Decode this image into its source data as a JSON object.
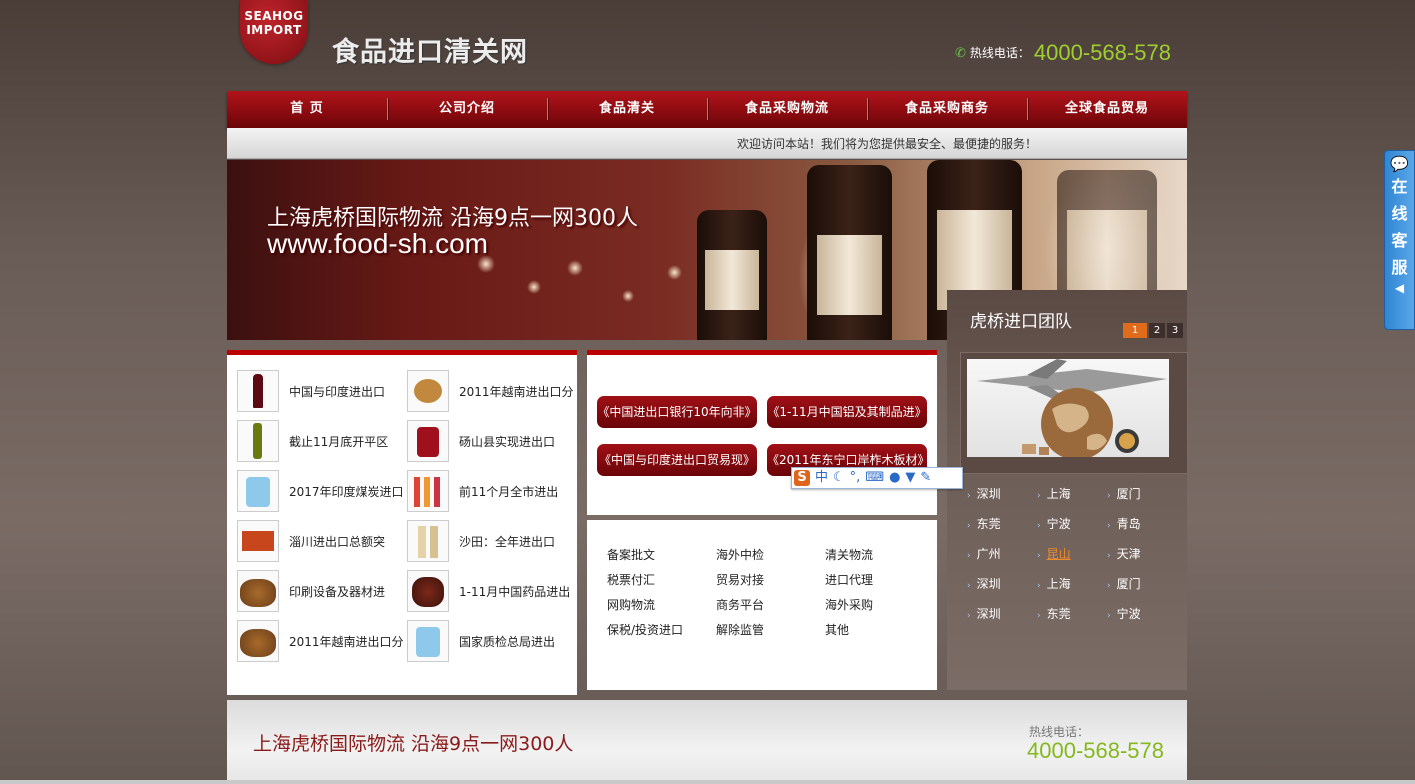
{
  "header": {
    "logo_line1": "SEAHOG",
    "logo_line2": "IMPORT",
    "site_title": "食品进口清关网",
    "hotline_label": "热线电话：",
    "hotline_number": "4000-568-578"
  },
  "nav": {
    "items": [
      "首  页",
      "公司介绍",
      "食品清关",
      "食品采购物流",
      "食品采购商务",
      "全球食品贸易"
    ]
  },
  "welcome": "欢迎访问本站！我们将为您提供最安全、最便捷的服务！",
  "banner": {
    "line1": "上海虎桥国际物流   沿海9点一网300人",
    "line2": "www.food-sh.com"
  },
  "team": {
    "title": "虎桥进口团队",
    "pages": [
      "1",
      "2",
      "3"
    ],
    "cities": [
      [
        "深圳",
        "上海",
        "厦门"
      ],
      [
        "东莞",
        "宁波",
        "青岛"
      ],
      [
        "广州",
        "昆山",
        "天津"
      ],
      [
        "深圳",
        "上海",
        "厦门"
      ],
      [
        "深圳",
        "东莞",
        "宁波"
      ]
    ]
  },
  "products": [
    {
      "name": "中国与印度进出口",
      "thumb": "wine-bottle"
    },
    {
      "name": "2011年越南进出口分",
      "thumb": "food-bowl"
    },
    {
      "name": "截止11月底开平区",
      "thumb": "oil-bottle"
    },
    {
      "name": "砀山县实现进出口",
      "thumb": "jam-jar"
    },
    {
      "name": "2017年印度煤炭进口",
      "thumb": "milk-can"
    },
    {
      "name": "前11个月全市进出",
      "thumb": "bottles"
    },
    {
      "name": "淄川进出口总额突",
      "thumb": "snack-box"
    },
    {
      "name": "沙田：全年进出口",
      "thumb": "drink-bottles"
    },
    {
      "name": "印刷设备及器材进",
      "thumb": "nuts"
    },
    {
      "name": "1-11月中国药品进出",
      "thumb": "dates"
    },
    {
      "name": "2011年越南进出口分",
      "thumb": "nuts"
    },
    {
      "name": "国家质检总局进出",
      "thumb": "milk-can"
    }
  ],
  "news": [
    "《中国进出口银行10年向非》",
    "《1-11月中国铝及其制品进》",
    "《中国与印度进出口贸易现》",
    "《2011年东宁口岸柞木板材》"
  ],
  "services": [
    [
      "备案批文",
      "海外中检",
      "清关物流"
    ],
    [
      "税票付汇",
      "贸易对接",
      "进口代理"
    ],
    [
      "网购物流",
      "商务平台",
      "海外采购"
    ],
    [
      "保税/投资进口",
      "解除监管",
      "其他"
    ]
  ],
  "ime": {
    "logo": "S",
    "mode": "中"
  },
  "footer": {
    "slogan": "上海虎桥国际物流   沿海9点一网300人",
    "hotline_label": "热线电话：",
    "hotline_number": "4000-568-578"
  },
  "side_service": {
    "chars": [
      "在",
      "线",
      "客",
      "服"
    ]
  },
  "colors": {
    "accent_red": "#9a0d12",
    "phone_green": "#9fcf2f",
    "highlight_orange": "#f08a2c"
  }
}
